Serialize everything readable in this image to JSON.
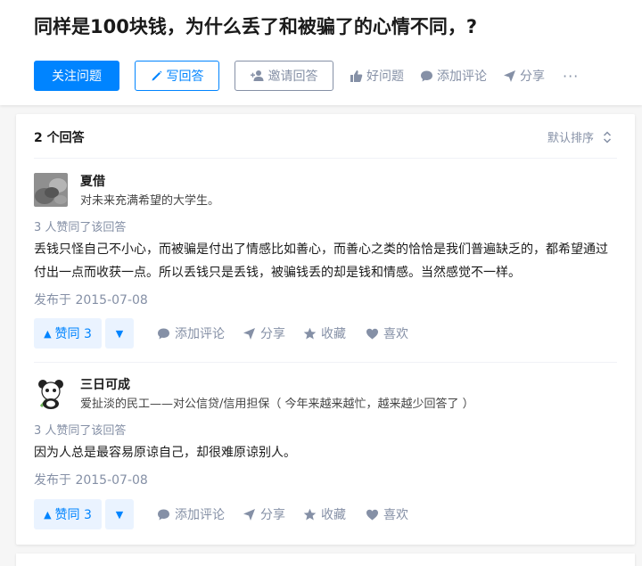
{
  "question": {
    "title": "同样是100块钱，为什么丢了和被骗了的心情不同，?"
  },
  "actions": {
    "follow_label": "关注问题",
    "write_label": "写回答",
    "invite_label": "邀请回答",
    "good_question_label": "好问题",
    "comment_label": "添加评论",
    "share_label": "分享",
    "more_label": "···"
  },
  "list": {
    "count_label": "2 个回答",
    "sort_label": "默认排序"
  },
  "answers": [
    {
      "author": "夏借",
      "headline": "对未来充满希望的大学生。",
      "voters": "3 人赞同了该回答",
      "content": "丢钱只怪自己不小心，而被骗是付出了情感比如善心，而善心之类的恰恰是我们普遍缺乏的，都希望通过付出一点而收获一点。所以丢钱只是丢钱，被骗钱丢的却是钱和情感。当然感觉不一样。",
      "date": "发布于 2015-07-08",
      "vote_label": "赞同 3",
      "comment_label": "添加评论",
      "share_label": "分享",
      "collect_label": "收藏",
      "like_label": "喜欢"
    },
    {
      "author": "三日可成",
      "headline": "爱扯淡的民工——对公信贷/信用担保（ 今年来越来越忙，越来越少回答了 ）",
      "voters": "3 人赞同了该回答",
      "content": "因为人总是最容易原谅自己，却很难原谅别人。",
      "date": "发布于 2015-07-08",
      "vote_label": "赞同 3",
      "comment_label": "添加评论",
      "share_label": "分享",
      "collect_label": "收藏",
      "like_label": "喜欢"
    }
  ],
  "colors": {
    "brand_blue": "#0084ff",
    "gray_text": "#8590a6",
    "vote_bg": "#eaf3ff"
  },
  "icons": {
    "write": "pencil-icon",
    "invite": "add-user-icon",
    "good_question": "thumb-up-icon",
    "comment": "comment-bubble-icon",
    "share": "paper-plane-icon",
    "more": "more-dots-icon",
    "sort": "sort-updown-icon",
    "collect": "star-icon",
    "like": "heart-icon"
  }
}
